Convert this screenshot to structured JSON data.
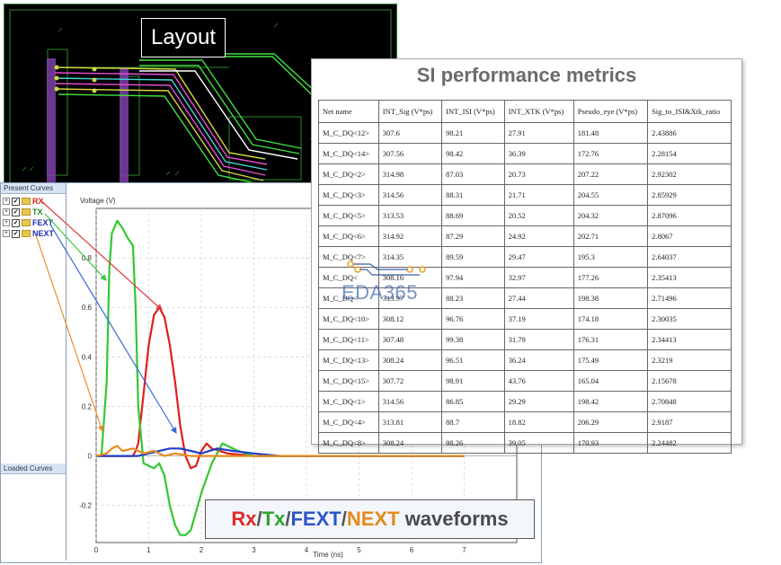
{
  "layout_panel": {
    "title": "Layout"
  },
  "metrics": {
    "title": "SI performance metrics",
    "columns": [
      "Net name",
      "INT_Sig (V*ps)",
      "INT_ISI (V*ps)",
      "INT_XTK (V*ps)",
      "Pseudo_eye (V*ps)",
      "Sig_to_ISI&Xtk_ratio"
    ],
    "rows": [
      [
        "M_C_DQ<12>",
        "307.6",
        "98.21",
        "27.91",
        "181.48",
        "2.43886"
      ],
      [
        "M_C_DQ<14>",
        "307.56",
        "98.42",
        "36.39",
        "172.76",
        "2.28154"
      ],
      [
        "M_C_DQ<2>",
        "314.98",
        "87.03",
        "20.73",
        "207.22",
        "2.92302"
      ],
      [
        "M_C_DQ<3>",
        "314.56",
        "88.31",
        "21.71",
        "204.55",
        "2.85929"
      ],
      [
        "M_C_DQ<5>",
        "313.53",
        "88.69",
        "20.52",
        "204.32",
        "2.87096"
      ],
      [
        "M_C_DQ<6>",
        "314.92",
        "87.29",
        "24.92",
        "202.71",
        "2.8067"
      ],
      [
        "M_C_DQ<7>",
        "314.35",
        "89.59",
        "29.47",
        "195.3",
        "2.64037"
      ],
      [
        "M_C_DQ<",
        "308.16",
        "97.94",
        "32.97",
        "177.26",
        "2.35413"
      ],
      [
        "M_C_DQ<",
        "313.97",
        "88.23",
        "27.44",
        "198.38",
        "2.71496"
      ],
      [
        "M_C_DQ<10>",
        "308.12",
        "96.76",
        "37.19",
        "174.18",
        "2.30035"
      ],
      [
        "M_C_DQ<11>",
        "307.48",
        "99.38",
        "31.79",
        "176.31",
        "2.34413"
      ],
      [
        "M_C_DQ<13>",
        "308.24",
        "96.51",
        "36.24",
        "175.49",
        "2.3219"
      ],
      [
        "M_C_DQ<15>",
        "307.72",
        "98.91",
        "43.76",
        "165.04",
        "2.15678"
      ],
      [
        "M_C_DQ<1>",
        "314.56",
        "86.85",
        "29.29",
        "198.42",
        "2.70848"
      ],
      [
        "M_C_DQ<4>",
        "313.81",
        "88.7",
        "18.82",
        "206.29",
        "2.9187"
      ],
      [
        "M_C_DQ<8>",
        "308.24",
        "98.26",
        "39.05",
        "170.93",
        "2.24482"
      ]
    ]
  },
  "curves_panel": {
    "present_label": "Present Curves",
    "loaded_label": "Loaded Curves",
    "items": [
      {
        "name": "RX",
        "color": "#d42020"
      },
      {
        "name": "TX",
        "color": "#1c8a1c"
      },
      {
        "name": "FEXT",
        "color": "#1f2fb0"
      },
      {
        "name": "NEXT",
        "color": "#1f2fb0"
      }
    ]
  },
  "caption": {
    "parts": [
      {
        "text": "Rx",
        "color": "#e02a2a"
      },
      {
        "text": "/",
        "color": "#555555"
      },
      {
        "text": "Tx",
        "color": "#2aa52a"
      },
      {
        "text": "/",
        "color": "#555555"
      },
      {
        "text": "FEXT",
        "color": "#2f54c8"
      },
      {
        "text": "/",
        "color": "#555555"
      },
      {
        "text": "NEXT",
        "color": "#e58a1e"
      },
      {
        "text": " waveforms",
        "color": "#4a4a4a"
      }
    ]
  },
  "watermark": {
    "text": "EDA365"
  },
  "chart_data": {
    "type": "line",
    "xlabel": "Time (ns)",
    "ylabel": "Voltage (V)",
    "xlim": [
      0,
      8
    ],
    "ylim": [
      -0.35,
      1.0
    ],
    "xticks": [
      "0",
      "1",
      "2",
      "3",
      "4",
      "5",
      "6",
      "7"
    ],
    "yticks": [
      "0.8",
      "0.6",
      "0.4",
      "0.2",
      "0",
      "-0.2"
    ],
    "ytick_values": [
      0.8,
      0.6,
      0.4,
      0.2,
      0,
      -0.2
    ],
    "grid": true,
    "series": [
      {
        "name": "RX",
        "color": "#e01e1e",
        "x": [
          0,
          0.7,
          0.75,
          0.8,
          0.9,
          1.0,
          1.1,
          1.2,
          1.3,
          1.4,
          1.5,
          1.6,
          1.7,
          1.8,
          1.9,
          2.0,
          2.1,
          2.2,
          2.5,
          3.0,
          4.0,
          5.0,
          6.0,
          7.0
        ],
        "y": [
          0,
          0,
          0.02,
          0.05,
          0.25,
          0.45,
          0.57,
          0.6,
          0.56,
          0.45,
          0.3,
          0.12,
          0.0,
          -0.05,
          -0.04,
          0.02,
          0.05,
          0.03,
          0.01,
          0.0,
          0.0,
          0.0,
          0.0,
          0.0
        ]
      },
      {
        "name": "TX",
        "color": "#32c832",
        "x": [
          0,
          0.1,
          0.2,
          0.25,
          0.3,
          0.4,
          0.5,
          0.6,
          0.7,
          0.75,
          0.8,
          0.9,
          1.0,
          1.1,
          1.2,
          1.3,
          1.4,
          1.5,
          1.6,
          1.7,
          1.8,
          2.0,
          2.2,
          2.4,
          2.7,
          3.0,
          3.5,
          4.0,
          5.0,
          6.0,
          7.0
        ],
        "y": [
          0,
          0,
          0.3,
          0.75,
          0.9,
          0.95,
          0.92,
          0.88,
          0.85,
          0.6,
          0.2,
          -0.03,
          -0.04,
          -0.05,
          -0.03,
          -0.08,
          -0.2,
          -0.28,
          -0.32,
          -0.32,
          -0.3,
          -0.15,
          -0.03,
          0.05,
          0.02,
          0.0,
          0.0,
          0.0,
          0.0,
          0.0,
          0.0
        ]
      },
      {
        "name": "FEXT",
        "color": "#1f3fc8",
        "x": [
          0,
          0.8,
          1.0,
          1.2,
          1.4,
          1.6,
          1.8,
          2.0,
          2.3,
          2.6,
          3.0,
          3.5,
          4.0,
          5.0,
          7.0
        ],
        "y": [
          0,
          0,
          0.01,
          0.02,
          0.03,
          0.03,
          0.02,
          0.01,
          0.03,
          0.02,
          0.01,
          0.0,
          0.0,
          0.0,
          0.0
        ]
      },
      {
        "name": "NEXT",
        "color": "#e88a1e",
        "x": [
          0,
          0.2,
          0.3,
          0.4,
          0.5,
          0.7,
          0.9,
          1.1,
          1.3,
          1.5,
          1.8,
          2.2,
          2.6,
          3.0,
          4.0,
          7.0
        ],
        "y": [
          0,
          0.01,
          0.03,
          0.04,
          0.02,
          0.03,
          0.01,
          0.02,
          0.0,
          0.01,
          0.0,
          0.0,
          0.0,
          0.0,
          0.0,
          0.0
        ]
      }
    ]
  }
}
